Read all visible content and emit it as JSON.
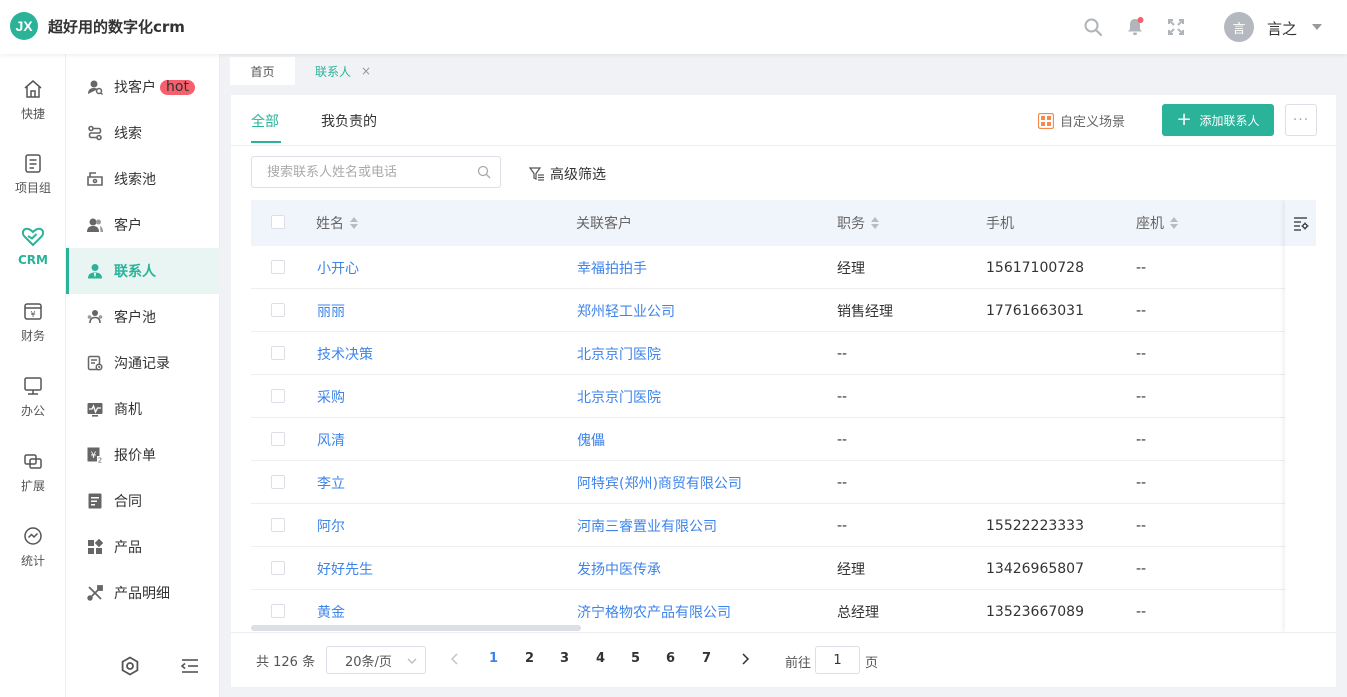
{
  "app": {
    "logo_text": "JX",
    "title": "超好用的数字化crm"
  },
  "header": {
    "user_name": "言之",
    "avatar_text": "言"
  },
  "rail": [
    {
      "label": "快捷",
      "icon": "home-icon"
    },
    {
      "label": "项目组",
      "icon": "project-icon"
    },
    {
      "label": "CRM",
      "icon": "crm-icon"
    },
    {
      "label": "财务",
      "icon": "finance-icon"
    },
    {
      "label": "办公",
      "icon": "office-icon"
    },
    {
      "label": "扩展",
      "icon": "extend-icon"
    },
    {
      "label": "统计",
      "icon": "stats-icon"
    }
  ],
  "submenu": [
    {
      "label": "找客户",
      "badge": "hot",
      "icon": "find-customer-icon"
    },
    {
      "label": "线索",
      "icon": "lead-icon"
    },
    {
      "label": "线索池",
      "icon": "lead-pool-icon"
    },
    {
      "label": "客户",
      "icon": "customer-icon"
    },
    {
      "label": "联系人",
      "icon": "contact-icon"
    },
    {
      "label": "客户池",
      "icon": "customer-pool-icon"
    },
    {
      "label": "沟通记录",
      "icon": "record-icon"
    },
    {
      "label": "商机",
      "icon": "opportunity-icon"
    },
    {
      "label": "报价单",
      "icon": "quote-icon"
    },
    {
      "label": "合同",
      "icon": "contract-icon"
    },
    {
      "label": "产品",
      "icon": "product-icon"
    },
    {
      "label": "产品明细",
      "icon": "product-detail-icon"
    }
  ],
  "page_tabs": {
    "home": "首页",
    "contacts": "联系人",
    "close": "×"
  },
  "scene_tabs": {
    "all": "全部",
    "mine": "我负责的"
  },
  "toolbar": {
    "custom_scene": "自定义场景",
    "add_contact": "添加联系人",
    "more": "···"
  },
  "search": {
    "placeholder": "搜索联系人姓名或电话",
    "value": ""
  },
  "filter": {
    "label": "高级筛选"
  },
  "table": {
    "columns": {
      "name": "姓名",
      "customer": "关联客户",
      "position": "职务",
      "mobile": "手机",
      "phone": "座机"
    },
    "rows": [
      {
        "name": "小开心",
        "customer": "幸福拍拍手",
        "position": "经理",
        "mobile": "15617100728",
        "phone": "--"
      },
      {
        "name": "丽丽",
        "customer": "郑州轻工业公司",
        "position": "销售经理",
        "mobile": "17761663031",
        "phone": "--"
      },
      {
        "name": "技术决策",
        "customer": "北京京门医院",
        "position": "--",
        "mobile": "",
        "phone": "--"
      },
      {
        "name": "采购",
        "customer": "北京京门医院",
        "position": "--",
        "mobile": "",
        "phone": "--"
      },
      {
        "name": "风清",
        "customer": "傀儡",
        "position": "--",
        "mobile": "",
        "phone": "--"
      },
      {
        "name": "李立",
        "customer": "阿特宾(郑州)商贸有限公司",
        "position": "--",
        "mobile": "",
        "phone": "--"
      },
      {
        "name": "阿尔",
        "customer": "河南三睿置业有限公司",
        "position": "--",
        "mobile": "15522223333",
        "phone": "--"
      },
      {
        "name": "好好先生",
        "customer": "发扬中医传承",
        "position": "经理",
        "mobile": "13426965807",
        "phone": "--"
      },
      {
        "name": "黄金",
        "customer": "济宁格物农产品有限公司",
        "position": "总经理",
        "mobile": "13523667089",
        "phone": "--"
      }
    ]
  },
  "pagination": {
    "total": "共 126 条",
    "page_size": "20条/页",
    "pages": [
      "1",
      "2",
      "3",
      "4",
      "5",
      "6",
      "7"
    ],
    "current": "1",
    "goto_label": "前往",
    "goto_value": "1",
    "goto_suffix": "页"
  },
  "colors": {
    "accent": "#2bb39a",
    "link": "#3e84e9",
    "hot": "#f4606c",
    "header_bg": "#f0f4fb"
  }
}
